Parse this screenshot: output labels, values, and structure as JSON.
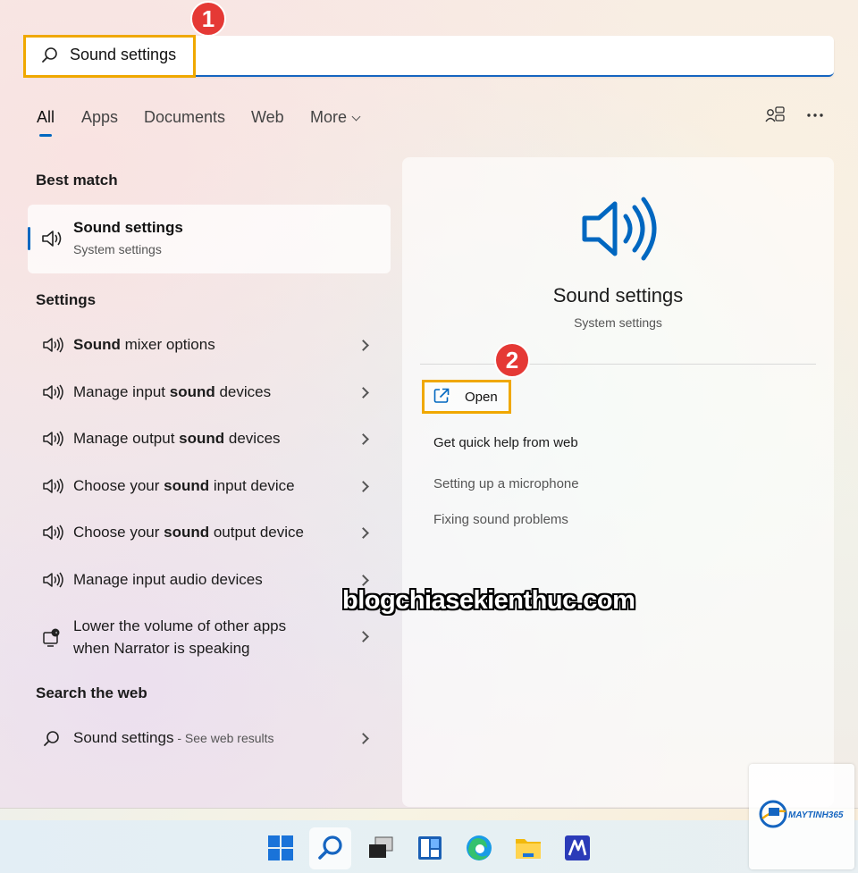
{
  "search": {
    "value": "Sound settings",
    "badge": "1"
  },
  "tabs": [
    {
      "label": "All",
      "active": true
    },
    {
      "label": "Apps"
    },
    {
      "label": "Documents"
    },
    {
      "label": "Web"
    },
    {
      "label": "More"
    }
  ],
  "best_match": {
    "heading": "Best match",
    "title": "Sound settings",
    "subtitle": "System settings"
  },
  "settings": {
    "heading": "Settings",
    "items": [
      {
        "pre": "",
        "bold": "Sound",
        "post": " mixer options"
      },
      {
        "pre": "Manage input ",
        "bold": "sound",
        "post": " devices"
      },
      {
        "pre": "Manage output ",
        "bold": "sound",
        "post": " devices"
      },
      {
        "pre": "Choose your ",
        "bold": "sound",
        "post": " input device"
      },
      {
        "pre": "Choose your ",
        "bold": "sound",
        "post": " output device"
      },
      {
        "pre": "Manage input audio devices",
        "bold": "",
        "post": ""
      }
    ],
    "narrator_line1": "Lower the volume of other apps",
    "narrator_line2": "when Narrator is speaking"
  },
  "web": {
    "heading": "Search the web",
    "query": "Sound settings",
    "suffix": " - See web results"
  },
  "preview": {
    "title": "Sound settings",
    "subtitle": "System settings",
    "badge": "2",
    "open_label": "Open",
    "help_heading": "Get quick help from web",
    "help_links": [
      "Setting up a microphone",
      "Fixing sound problems"
    ]
  },
  "watermark": "blogchiasekienthuc.com",
  "logo": {
    "text": "MAYTINH365"
  },
  "taskbar": {
    "icons": [
      "windows-start-icon",
      "search-icon",
      "task-view-icon",
      "widgets-icon",
      "edge-browser-icon",
      "file-explorer-icon",
      "app-icon"
    ]
  },
  "colors": {
    "accent": "#0067c0",
    "highlight": "#f0a800",
    "badge": "#e53935"
  }
}
